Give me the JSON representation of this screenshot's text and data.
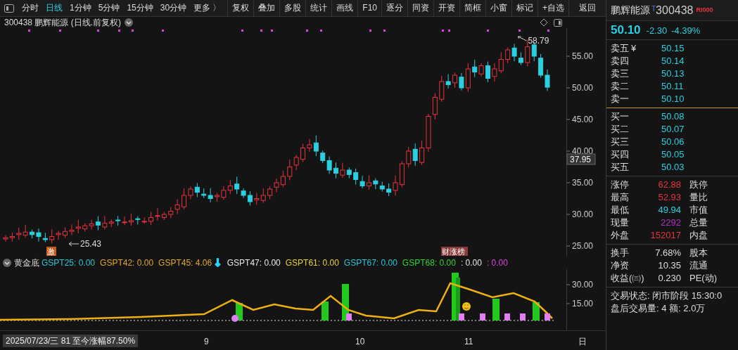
{
  "toolbar": {
    "periods": [
      {
        "label": "分时",
        "selected": false
      },
      {
        "label": "日线",
        "selected": true
      },
      {
        "label": "1分钟",
        "selected": false
      },
      {
        "label": "5分钟",
        "selected": false
      },
      {
        "label": "15分钟",
        "selected": false
      },
      {
        "label": "30分钟",
        "selected": false
      },
      {
        "label": "更多 〉",
        "selected": false
      }
    ],
    "buttons": [
      "复权",
      "叠加",
      "多股",
      "统计",
      "画线",
      "F10",
      "逐分",
      "同资",
      "开资",
      "简框",
      "小窗",
      "标记",
      "+自选",
      "返回"
    ]
  },
  "chart": {
    "title": "300438 鹏辉能源 (日线.前复权)",
    "price_ticks": [
      "55.00",
      "50.00",
      "45.00",
      "40.00",
      "35.00",
      "30.00",
      "25.00"
    ],
    "cursor_price": "37.95",
    "high_label": "58.79",
    "low_label": "25.43",
    "markers": [
      "激",
      "财涨榜"
    ]
  },
  "indicator": {
    "name": "黄金底",
    "legend": [
      {
        "text": "GSPT25: 0.00",
        "color": "#27c7d6"
      },
      {
        "text": "GSPT42: 0.00",
        "color": "#e0a82a"
      },
      {
        "text": "GSPT45: 4.06",
        "color": "#e0a82a"
      },
      {
        "text": "↓",
        "color": "#2bd3f0"
      },
      {
        "text": "GSPT47: 0.00",
        "color": "#e8e8e8"
      },
      {
        "text": "GSPT61: 0.00",
        "color": "#e8d22e"
      },
      {
        "text": "GSPT67: 0.00",
        "color": "#27c7d6"
      },
      {
        "text": "GSPT68: 0.00",
        "color": "#2ed62e"
      },
      {
        "text": ": 0.00",
        "color": "#e8e8e8"
      },
      {
        "text": ": 0.00",
        "color": "#e040e0"
      }
    ],
    "ticks": [
      "30.00",
      "15.00"
    ]
  },
  "date_axis": {
    "cursor_label": "2025/07/23/三 81 至今涨幅87.50%",
    "ticks": [
      "9",
      "10",
      "11"
    ],
    "edge_label": "日"
  },
  "quote": {
    "name": "鹏辉能源",
    "tag": "T",
    "code": "300438",
    "badge": "RI000",
    "price": "50.10",
    "change": "-2.30",
    "change_pct": "-4.39%",
    "currency": "¥",
    "asks": [
      {
        "label": "卖五",
        "price": "50.15"
      },
      {
        "label": "卖四",
        "price": "50.14"
      },
      {
        "label": "卖三",
        "price": "50.13"
      },
      {
        "label": "卖二",
        "price": "50.11"
      },
      {
        "label": "卖一",
        "price": "50.10"
      }
    ],
    "bids": [
      {
        "label": "买一",
        "price": "50.08"
      },
      {
        "label": "买二",
        "price": "50.07"
      },
      {
        "label": "买三",
        "price": "50.06"
      },
      {
        "label": "买四",
        "price": "50.05"
      },
      {
        "label": "买五",
        "price": "50.03"
      }
    ],
    "stats": [
      {
        "label": "涨停",
        "value": "62.88",
        "color": "#e8323f",
        "label2": "跌停"
      },
      {
        "label": "最高",
        "value": "52.93",
        "color": "#e8323f",
        "label2": "量比"
      },
      {
        "label": "最低",
        "value": "49.94",
        "color": "#2ad0dc",
        "label2": "市值"
      },
      {
        "label": "现量",
        "value": "2292",
        "color": "#b030c8",
        "label2": "总量"
      },
      {
        "label": "外盘",
        "value": "152017",
        "color": "#e8323f",
        "label2": "内盘"
      }
    ],
    "fundamentals": [
      {
        "label": "换手",
        "value": "7.68%",
        "label2": "股本"
      },
      {
        "label": "净资",
        "value": "10.35",
        "label2": "流通"
      },
      {
        "label": "收益(㈢)",
        "value": "0.230",
        "label2": "PE(动)"
      }
    ],
    "status": [
      "交易状态: 闭市阶段 15:30:0",
      "盘后交易量: 4  额: 2.0万"
    ]
  }
}
